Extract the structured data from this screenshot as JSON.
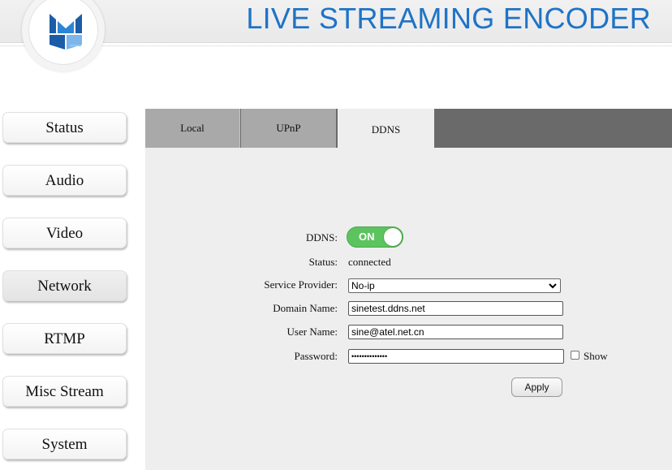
{
  "header": {
    "title": "LIVE STREAMING ENCODER",
    "logo_icon": "encoder-logo-icon",
    "title_color": "#1f73c7"
  },
  "sidebar": {
    "items": [
      {
        "label": "Status"
      },
      {
        "label": "Audio"
      },
      {
        "label": "Video"
      },
      {
        "label": "Network",
        "active": true
      },
      {
        "label": "RTMP"
      },
      {
        "label": "Misc Stream"
      },
      {
        "label": "System"
      }
    ]
  },
  "tabs": {
    "local": "Local",
    "upnp": "UPnP",
    "ddns": "DDNS",
    "active": "DDNS"
  },
  "form": {
    "ddns_label": "DDNS:",
    "ddns_toggle": "ON",
    "toggle_color": "#5cc45f",
    "status_label": "Status:",
    "status_value": "connected",
    "provider_label": "Service Provider:",
    "provider_value": "No-ip",
    "domain_label": "Domain Name:",
    "domain_value": "sinetest.ddns.net",
    "user_label": "User Name:",
    "user_value": "sine@atel.net.cn",
    "password_label": "Password:",
    "password_value": "••••••••••••••",
    "show_label": "Show",
    "apply_label": "Apply"
  }
}
